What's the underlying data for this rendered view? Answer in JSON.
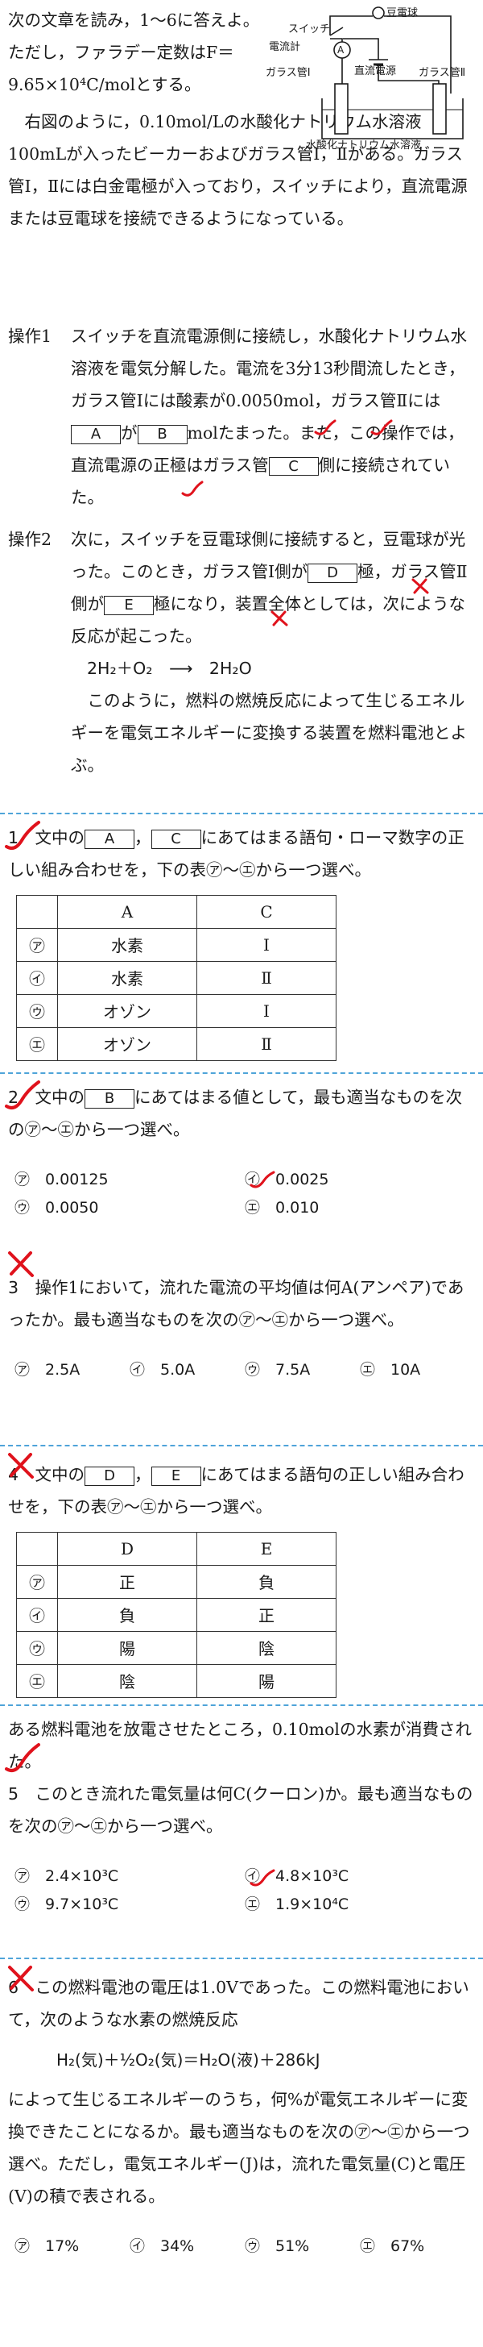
{
  "intro": {
    "text": "次の文章を読み，1～6に答えよ。ただし，ファラデー定数はF＝9.65×10⁴C/molとする。",
    "paragraph": "右図のように，0.10mol/Lの水酸化ナトリウム水溶液100mLが入ったビーカーおよびガラス管Ⅰ，Ⅱがある。ガラス管Ⅰ，Ⅱには白金電極が入っており，スイッチにより，直流電源または豆電球を接続できるようになっている。"
  },
  "diagram": {
    "switch": "スイッチ",
    "bulb": "豆電球",
    "ammeter": "電流計",
    "ammeter_symbol": "A",
    "tube1": "ガラス管Ⅰ",
    "tube2": "ガラス管Ⅱ",
    "power": "直流電源",
    "solution": "水酸化ナトリウム水溶液"
  },
  "op1": {
    "label": "操作1",
    "t1": "スイッチを直流電源側に接続し，水酸化ナトリウム水溶液を電気分解した。電流を3分13秒間流したとき，ガラス管Ⅰには酸素が0.0050mol，ガラス管Ⅱには",
    "box_a": "A",
    "t2": "が",
    "box_b": "B",
    "t3": "molたまった。また，この操作では，直流電源の正極はガラス管",
    "box_c": "C",
    "t4": "側に接続されていた。"
  },
  "op2": {
    "label": "操作2",
    "t1": "次に，スイッチを豆電球側に接続すると，豆電球が光った。このとき，ガラス管Ⅰ側が",
    "box_d": "D",
    "t2": "極，ガラス管Ⅱ側が",
    "box_e": "E",
    "t3": "極になり，装置全体としては，次にような反応が起こった。",
    "equation_left": "2H₂＋O₂",
    "equation_arrow": "⟶",
    "equation_right": "2H₂O",
    "t4": "このように，燃料の燃焼反応によって生じるエネルギーを電気エネルギーに変換する装置を燃料電池とよぶ。"
  },
  "q1": {
    "num": "1",
    "t1": "文中の",
    "box1": "A",
    "sep": "，",
    "box2": "C",
    "t2": "にあてはまる語句・ローマ数字の正しい組み合わせを，下の表㋐～㋓から一つ選べ。",
    "header": [
      "",
      "A",
      "C"
    ],
    "rows": [
      [
        "㋐",
        "水素",
        "Ⅰ"
      ],
      [
        "㋑",
        "水素",
        "Ⅱ"
      ],
      [
        "㋒",
        "オゾン",
        "Ⅰ"
      ],
      [
        "㋓",
        "オゾン",
        "Ⅱ"
      ]
    ]
  },
  "q2": {
    "num": "2",
    "t1": "文中の",
    "box1": "B",
    "t2": "にあてはまる値として，最も適当なものを次の㋐～㋓から一つ選べ。",
    "choices": [
      "㋐　0.00125",
      "㋑　0.0025",
      "㋒　0.0050",
      "㋓　0.010"
    ]
  },
  "q3": {
    "num": "3",
    "t1": "操作1において，流れた電流の平均値は何A(アンペア)であったか。最も適当なものを次の㋐～㋓から一つ選べ。",
    "choices": [
      "㋐　2.5A",
      "㋑　5.0A",
      "㋒　7.5A",
      "㋓　10A"
    ]
  },
  "q4": {
    "num": "4",
    "t1": "文中の",
    "box1": "D",
    "sep": "，",
    "box2": "E",
    "t2": "にあてはまる語句の正しい組み合わせを，下の表㋐～㋓から一つ選べ。",
    "header": [
      "",
      "D",
      "E"
    ],
    "rows": [
      [
        "㋐",
        "正",
        "負"
      ],
      [
        "㋑",
        "負",
        "正"
      ],
      [
        "㋒",
        "陽",
        "陰"
      ],
      [
        "㋓",
        "陰",
        "陽"
      ]
    ]
  },
  "q5": {
    "pre": "ある燃料電池を放電させたところ，0.10molの水素が消費された。",
    "num": "5",
    "t1": "このとき流れた電気量は何C(クーロン)か。最も適当なものを次の㋐～㋓から一つ選べ。",
    "choices": [
      "㋐　2.4×10³C",
      "㋑　4.8×10³C",
      "㋒　9.7×10³C",
      "㋓　1.9×10⁴C"
    ]
  },
  "q6": {
    "num": "6",
    "t1": "この燃料電池の電圧は1.0Vであった。この燃料電池において，次のような水素の燃焼反応",
    "equation": "H₂(気)＋½O₂(気)＝H₂O(液)＋286kJ",
    "t2": "によって生じるエネルギーのうち，何%が電気エネルギーに変換できたことになるか。最も適当なものを次の㋐～㋓から一つ選べ。ただし，電気エネルギー(J)は，流れた電気量(C)と電圧(V)の積で表される。",
    "choices": [
      "㋐　17%",
      "㋑　34%",
      "㋒　51%",
      "㋓　67%"
    ]
  },
  "colors": {
    "mark": "#e0121c",
    "separator": "#4fa4d9",
    "text": "#1a1a1a"
  }
}
